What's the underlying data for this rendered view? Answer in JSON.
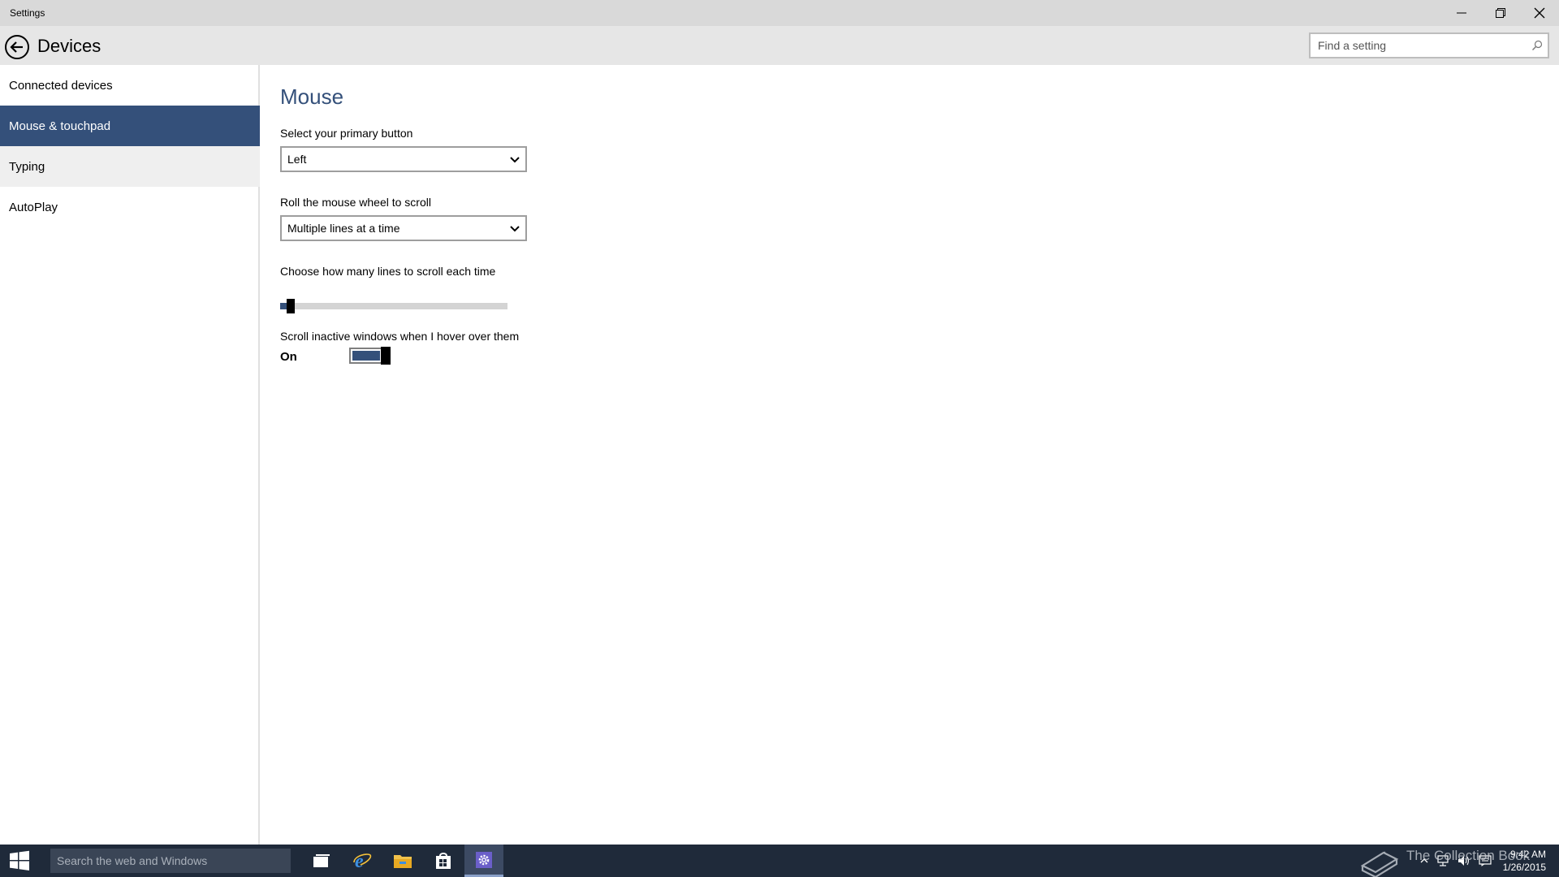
{
  "window": {
    "title": "Settings",
    "controls": {
      "minimize": "minimize-icon",
      "restore": "restore-icon",
      "close": "close-icon"
    }
  },
  "header": {
    "title": "Devices",
    "back_icon": "back-arrow-icon",
    "search_placeholder": "Find a setting",
    "search_icon": "search-icon"
  },
  "sidebar": {
    "items": [
      {
        "label": "Connected devices",
        "state": "normal"
      },
      {
        "label": "Mouse & touchpad",
        "state": "selected"
      },
      {
        "label": "Typing",
        "state": "hover"
      },
      {
        "label": "AutoPlay",
        "state": "normal"
      }
    ]
  },
  "main": {
    "section_title": "Mouse",
    "primary_button": {
      "label": "Select your primary button",
      "value": "Left"
    },
    "wheel_scroll": {
      "label": "Roll the mouse wheel to scroll",
      "value": "Multiple lines at a time"
    },
    "lines_slider": {
      "label": "Choose how many lines to scroll each time",
      "fraction": 0.02
    },
    "inactive_scroll": {
      "label": "Scroll inactive windows when I hover over them",
      "state": "On",
      "on": true
    }
  },
  "taskbar": {
    "search_placeholder": "Search the web and Windows",
    "apps": [
      "task-view-icon",
      "internet-explorer-icon",
      "file-explorer-icon",
      "store-icon",
      "settings-icon"
    ],
    "active_app": "settings-icon",
    "clock": {
      "time": "9:42 AM",
      "date": "1/26/2015"
    },
    "watermark": "The Collection Book"
  },
  "colors": {
    "accent": "#34507a",
    "title_bar": "#d9d9d9",
    "header_bar": "#e6e6e6",
    "taskbar": "#1f2a3a"
  }
}
